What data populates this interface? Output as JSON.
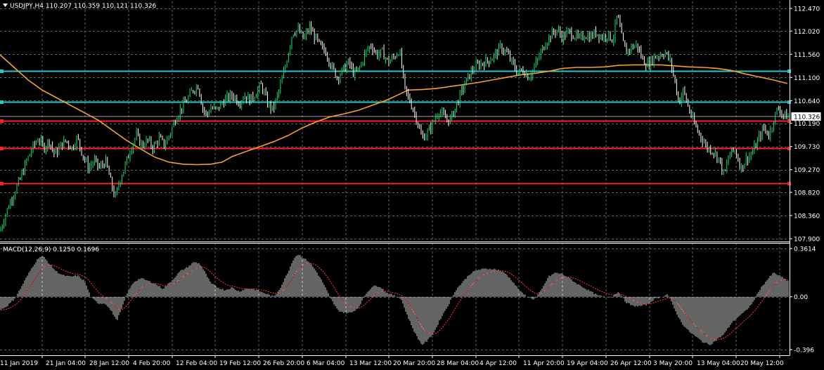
{
  "header": {
    "symbol_line": "USDJPY,H4  110.207 110.359 110.121 110.326",
    "macd_line": "MACD(12,26,9) 0.1250 0.1696"
  },
  "colors": {
    "background": "#000000",
    "grid": "#5b6270",
    "frame": "#ffffff",
    "bull_candle": "#00e676",
    "bear_candle": "#ffffff",
    "ma": "#f3a12a",
    "resistance_line": "#25c6c6",
    "support_line": "#ff2020",
    "macd_hist": "#c8c8c8",
    "macd_signal": "#ff3b3b",
    "current_price_box": "#ffffff"
  },
  "chart_data": [
    {
      "type": "candlestick",
      "symbol": "USDJPY",
      "timeframe": "H4",
      "ylim": [
        107.9,
        112.47
      ],
      "y_ticks": [
        "112.470",
        "112.020",
        "111.560",
        "111.100",
        "110.640",
        "110.190",
        "109.730",
        "109.270",
        "108.820",
        "108.360",
        "107.900"
      ],
      "current_price": "110.326",
      "x_ticks": [
        "11 Jan 2019",
        "21 Jan 04:00",
        "28 Jan 12:00",
        "4 Feb 20:00",
        "12 Feb 04:00",
        "19 Feb 12:00",
        "26 Feb 20:00",
        "6 Mar 04:00",
        "13 Mar 12:00",
        "20 Mar 20:00",
        "28 Mar 04:00",
        "4 Apr 12:00",
        "11 Apr 20:00",
        "19 Apr 04:00",
        "26 Apr 12:00",
        "3 May 20:00",
        "13 May 04:00",
        "20 May 12:00"
      ],
      "close_path": [
        [
          0,
          108.05
        ],
        [
          8,
          108.4
        ],
        [
          18,
          108.75
        ],
        [
          28,
          109.05
        ],
        [
          38,
          109.45
        ],
        [
          48,
          109.75
        ],
        [
          55,
          109.9
        ],
        [
          62,
          109.7
        ],
        [
          70,
          109.85
        ],
        [
          78,
          109.55
        ],
        [
          86,
          109.75
        ],
        [
          94,
          109.85
        ],
        [
          102,
          109.7
        ],
        [
          110,
          109.9
        ],
        [
          118,
          109.55
        ],
        [
          126,
          109.3
        ],
        [
          134,
          109.45
        ],
        [
          142,
          109.3
        ],
        [
          150,
          109.45
        ],
        [
          158,
          109.0
        ],
        [
          164,
          108.7
        ],
        [
          170,
          109.05
        ],
        [
          178,
          109.35
        ],
        [
          186,
          109.7
        ],
        [
          194,
          109.95
        ],
        [
          202,
          109.75
        ],
        [
          210,
          109.85
        ],
        [
          218,
          109.7
        ],
        [
          226,
          109.9
        ],
        [
          234,
          109.75
        ],
        [
          242,
          110.0
        ],
        [
          250,
          110.3
        ],
        [
          258,
          110.5
        ],
        [
          266,
          110.65
        ],
        [
          274,
          110.85
        ],
        [
          282,
          110.95
        ],
        [
          288,
          110.5
        ],
        [
          294,
          110.35
        ],
        [
          300,
          110.5
        ],
        [
          308,
          110.45
        ],
        [
          316,
          110.6
        ],
        [
          324,
          110.7
        ],
        [
          332,
          110.75
        ],
        [
          340,
          110.6
        ],
        [
          348,
          110.75
        ],
        [
          356,
          110.65
        ],
        [
          364,
          110.8
        ],
        [
          372,
          110.95
        ],
        [
          380,
          110.6
        ],
        [
          388,
          110.45
        ],
        [
          396,
          110.8
        ],
        [
          404,
          111.2
        ],
        [
          410,
          111.6
        ],
        [
          416,
          112.0
        ],
        [
          424,
          112.05
        ],
        [
          432,
          111.85
        ],
        [
          440,
          112.1
        ],
        [
          448,
          111.9
        ],
        [
          456,
          111.7
        ],
        [
          464,
          111.6
        ],
        [
          472,
          111.3
        ],
        [
          480,
          111.1
        ],
        [
          488,
          111.25
        ],
        [
          496,
          111.4
        ],
        [
          504,
          111.15
        ],
        [
          512,
          111.3
        ],
        [
          520,
          111.6
        ],
        [
          528,
          111.75
        ],
        [
          536,
          111.55
        ],
        [
          544,
          111.6
        ],
        [
          552,
          111.4
        ],
        [
          560,
          111.5
        ],
        [
          568,
          111.65
        ],
        [
          576,
          110.85
        ],
        [
          584,
          110.6
        ],
        [
          592,
          110.3
        ],
        [
          600,
          109.9
        ],
        [
          608,
          110.0
        ],
        [
          616,
          110.2
        ],
        [
          624,
          110.45
        ],
        [
          632,
          110.3
        ],
        [
          640,
          110.25
        ],
        [
          648,
          110.5
        ],
        [
          656,
          110.8
        ],
        [
          664,
          111.05
        ],
        [
          672,
          111.25
        ],
        [
          680,
          111.35
        ],
        [
          688,
          111.4
        ],
        [
          696,
          111.45
        ],
        [
          704,
          111.55
        ],
        [
          712,
          111.7
        ],
        [
          720,
          111.6
        ],
        [
          728,
          111.4
        ],
        [
          736,
          111.2
        ],
        [
          744,
          111.25
        ],
        [
          752,
          111.1
        ],
        [
          760,
          111.3
        ],
        [
          768,
          111.55
        ],
        [
          776,
          111.8
        ],
        [
          784,
          111.95
        ],
        [
          792,
          112.05
        ],
        [
          800,
          111.9
        ],
        [
          808,
          112.0
        ],
        [
          816,
          111.95
        ],
        [
          824,
          111.85
        ],
        [
          832,
          111.95
        ],
        [
          840,
          111.9
        ],
        [
          848,
          112.0
        ],
        [
          856,
          111.9
        ],
        [
          864,
          111.95
        ],
        [
          872,
          111.85
        ],
        [
          878,
          112.35
        ],
        [
          884,
          111.9
        ],
        [
          890,
          111.6
        ],
        [
          898,
          111.7
        ],
        [
          906,
          111.75
        ],
        [
          914,
          111.45
        ],
        [
          922,
          111.35
        ],
        [
          930,
          111.5
        ],
        [
          938,
          111.55
        ],
        [
          946,
          111.6
        ],
        [
          954,
          111.4
        ],
        [
          960,
          111.0
        ],
        [
          966,
          110.6
        ],
        [
          972,
          110.85
        ],
        [
          978,
          110.55
        ],
        [
          984,
          110.3
        ],
        [
          990,
          110.1
        ],
        [
          998,
          109.9
        ],
        [
          1006,
          109.7
        ],
        [
          1014,
          109.65
        ],
        [
          1022,
          109.5
        ],
        [
          1030,
          109.15
        ],
        [
          1038,
          109.6
        ],
        [
          1046,
          109.65
        ],
        [
          1054,
          109.3
        ],
        [
          1062,
          109.5
        ],
        [
          1070,
          109.6
        ],
        [
          1078,
          109.85
        ],
        [
          1086,
          110.1
        ],
        [
          1094,
          109.95
        ],
        [
          1102,
          110.35
        ],
        [
          1108,
          110.5
        ],
        [
          1114,
          110.35
        ],
        [
          1120,
          110.33
        ]
      ],
      "moving_average": [
        [
          0,
          111.55
        ],
        [
          20,
          111.3
        ],
        [
          40,
          111.05
        ],
        [
          60,
          110.85
        ],
        [
          80,
          110.7
        ],
        [
          100,
          110.55
        ],
        [
          120,
          110.4
        ],
        [
          140,
          110.25
        ],
        [
          160,
          110.05
        ],
        [
          180,
          109.85
        ],
        [
          200,
          109.68
        ],
        [
          220,
          109.52
        ],
        [
          240,
          109.42
        ],
        [
          260,
          109.38
        ],
        [
          280,
          109.37
        ],
        [
          300,
          109.38
        ],
        [
          316,
          109.42
        ],
        [
          330,
          109.53
        ],
        [
          350,
          109.63
        ],
        [
          370,
          109.73
        ],
        [
          390,
          109.83
        ],
        [
          410,
          109.95
        ],
        [
          430,
          110.1
        ],
        [
          450,
          110.22
        ],
        [
          470,
          110.32
        ],
        [
          490,
          110.38
        ],
        [
          510,
          110.45
        ],
        [
          530,
          110.55
        ],
        [
          550,
          110.65
        ],
        [
          570,
          110.78
        ],
        [
          580,
          110.85
        ],
        [
          600,
          110.86
        ],
        [
          620,
          110.88
        ],
        [
          640,
          110.92
        ],
        [
          660,
          110.96
        ],
        [
          680,
          111.0
        ],
        [
          700,
          111.05
        ],
        [
          720,
          111.1
        ],
        [
          740,
          111.15
        ],
        [
          760,
          111.18
        ],
        [
          780,
          111.22
        ],
        [
          800,
          111.28
        ],
        [
          820,
          111.3
        ],
        [
          840,
          111.3
        ],
        [
          860,
          111.31
        ],
        [
          880,
          111.34
        ],
        [
          900,
          111.35
        ],
        [
          920,
          111.35
        ],
        [
          940,
          111.35
        ],
        [
          960,
          111.33
        ],
        [
          980,
          111.31
        ],
        [
          1000,
          111.3
        ],
        [
          1020,
          111.28
        ],
        [
          1040,
          111.24
        ],
        [
          1060,
          111.17
        ],
        [
          1080,
          111.11
        ],
        [
          1100,
          111.05
        ],
        [
          1120,
          110.98
        ]
      ],
      "horizontal_levels": [
        {
          "kind": "resistance",
          "price": 111.23
        },
        {
          "kind": "resistance",
          "price": 110.61
        },
        {
          "kind": "support",
          "price": 110.24
        },
        {
          "kind": "support",
          "price": 109.7
        },
        {
          "kind": "support",
          "price": 109.0
        }
      ]
    },
    {
      "type": "bar",
      "indicator": "MACD(12,26,9)",
      "ylim": [
        -0.396,
        0.3614
      ],
      "y_ticks": [
        "0.3614",
        "0.00",
        "-0.396"
      ],
      "histogram_path": [
        [
          0,
          -0.1
        ],
        [
          10,
          -0.07
        ],
        [
          20,
          -0.02
        ],
        [
          28,
          0.05
        ],
        [
          38,
          0.15
        ],
        [
          48,
          0.24
        ],
        [
          56,
          0.3
        ],
        [
          62,
          0.3
        ],
        [
          70,
          0.25
        ],
        [
          80,
          0.19
        ],
        [
          90,
          0.16
        ],
        [
          100,
          0.15
        ],
        [
          110,
          0.16
        ],
        [
          120,
          0.12
        ],
        [
          130,
          -0.01
        ],
        [
          140,
          -0.05
        ],
        [
          150,
          -0.05
        ],
        [
          160,
          -0.12
        ],
        [
          166,
          -0.18
        ],
        [
          174,
          -0.08
        ],
        [
          180,
          0.02
        ],
        [
          190,
          0.11
        ],
        [
          200,
          0.14
        ],
        [
          210,
          0.12
        ],
        [
          220,
          0.1
        ],
        [
          232,
          0.06
        ],
        [
          244,
          0.12
        ],
        [
          256,
          0.19
        ],
        [
          266,
          0.22
        ],
        [
          276,
          0.26
        ],
        [
          284,
          0.25
        ],
        [
          292,
          0.18
        ],
        [
          300,
          0.1
        ],
        [
          310,
          0.07
        ],
        [
          320,
          0.05
        ],
        [
          330,
          0.07
        ],
        [
          340,
          0.04
        ],
        [
          350,
          0.06
        ],
        [
          360,
          0.06
        ],
        [
          370,
          0.04
        ],
        [
          380,
          0.02
        ],
        [
          390,
          0.0
        ],
        [
          400,
          0.08
        ],
        [
          410,
          0.19
        ],
        [
          418,
          0.29
        ],
        [
          424,
          0.32
        ],
        [
          432,
          0.29
        ],
        [
          440,
          0.26
        ],
        [
          450,
          0.19
        ],
        [
          460,
          0.1
        ],
        [
          470,
          -0.01
        ],
        [
          480,
          -0.1
        ],
        [
          490,
          -0.12
        ],
        [
          500,
          -0.12
        ],
        [
          510,
          -0.08
        ],
        [
          520,
          0.02
        ],
        [
          530,
          0.08
        ],
        [
          540,
          0.08
        ],
        [
          550,
          0.03
        ],
        [
          560,
          0.01
        ],
        [
          570,
          -0.01
        ],
        [
          580,
          -0.15
        ],
        [
          590,
          -0.27
        ],
        [
          600,
          -0.36
        ],
        [
          608,
          -0.33
        ],
        [
          618,
          -0.26
        ],
        [
          628,
          -0.15
        ],
        [
          638,
          -0.06
        ],
        [
          648,
          0.05
        ],
        [
          658,
          0.11
        ],
        [
          668,
          0.17
        ],
        [
          678,
          0.2
        ],
        [
          690,
          0.21
        ],
        [
          700,
          0.21
        ],
        [
          710,
          0.2
        ],
        [
          720,
          0.17
        ],
        [
          730,
          0.11
        ],
        [
          740,
          0.04
        ],
        [
          750,
          0.0
        ],
        [
          760,
          -0.02
        ],
        [
          770,
          0.05
        ],
        [
          780,
          0.15
        ],
        [
          790,
          0.18
        ],
        [
          800,
          0.17
        ],
        [
          810,
          0.14
        ],
        [
          820,
          0.1
        ],
        [
          830,
          0.07
        ],
        [
          840,
          0.04
        ],
        [
          850,
          0.01
        ],
        [
          860,
          0.0
        ],
        [
          870,
          0.0
        ],
        [
          880,
          0.04
        ],
        [
          890,
          -0.04
        ],
        [
          900,
          -0.07
        ],
        [
          910,
          -0.07
        ],
        [
          920,
          -0.06
        ],
        [
          930,
          -0.02
        ],
        [
          940,
          0.0
        ],
        [
          950,
          0.02
        ],
        [
          960,
          -0.1
        ],
        [
          970,
          -0.2
        ],
        [
          980,
          -0.26
        ],
        [
          990,
          -0.3
        ],
        [
          1000,
          -0.34
        ],
        [
          1010,
          -0.36
        ],
        [
          1020,
          -0.32
        ],
        [
          1030,
          -0.28
        ],
        [
          1040,
          -0.2
        ],
        [
          1050,
          -0.15
        ],
        [
          1060,
          -0.11
        ],
        [
          1070,
          -0.05
        ],
        [
          1080,
          0.05
        ],
        [
          1090,
          0.12
        ],
        [
          1100,
          0.18
        ],
        [
          1108,
          0.16
        ],
        [
          1114,
          0.14
        ],
        [
          1120,
          0.12
        ]
      ]
    }
  ]
}
